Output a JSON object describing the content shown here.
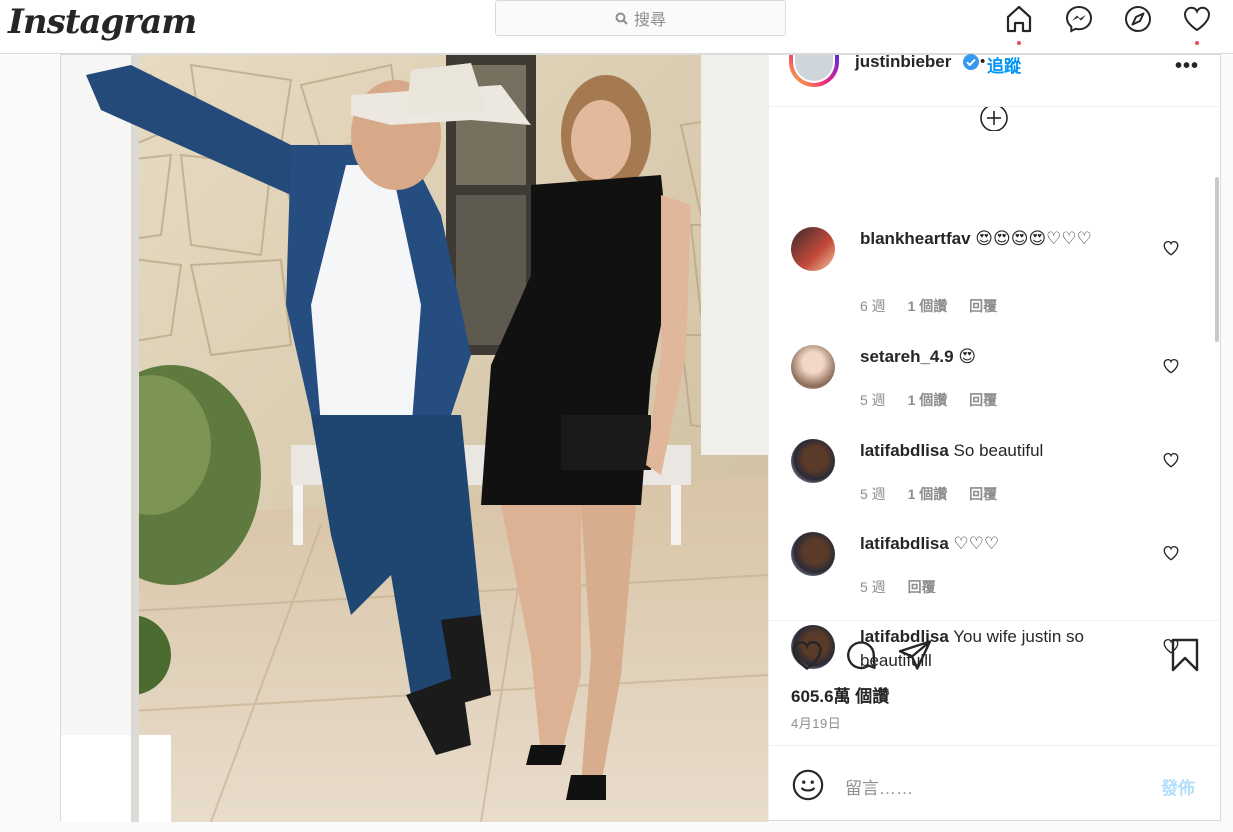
{
  "topnav": {
    "logo": "Instagram",
    "search_placeholder": "搜尋",
    "icons": [
      "home-icon",
      "messenger-icon",
      "explore-icon",
      "activity-heart-icon"
    ]
  },
  "post": {
    "author": "justinbieber",
    "follow_label": "追蹤",
    "separator": "•",
    "more_label": "•••",
    "comments": [
      {
        "user": "blankheartfav",
        "text": "😍😍😍😍♡♡♡",
        "age": "6 週",
        "likes": "1 個讚",
        "reply": "回覆"
      },
      {
        "user": "setareh_4.9",
        "text": "😍",
        "age": "5 週",
        "likes": "1 個讚",
        "reply": "回覆"
      },
      {
        "user": "latifabdlisa",
        "text": "So beautiful",
        "age": "5 週",
        "likes": "1 個讚",
        "reply": "回覆"
      },
      {
        "user": "latifabdlisa",
        "text": "♡♡♡",
        "age": "5 週",
        "likes": "",
        "reply": "回覆"
      },
      {
        "user": "latifabdlisa",
        "text": "You wife justin so beautifulll",
        "age": "",
        "likes": "",
        "reply": ""
      }
    ],
    "like_count": "605.6萬 個讚",
    "date": "4月19日",
    "comment_placeholder": "留言……",
    "post_button": "發佈"
  },
  "colors": {
    "link_blue": "#0095f6",
    "notification_dot": "#ed4956",
    "post_button_disabled": "#b2dffc",
    "muted_text": "#8e8e8e"
  }
}
